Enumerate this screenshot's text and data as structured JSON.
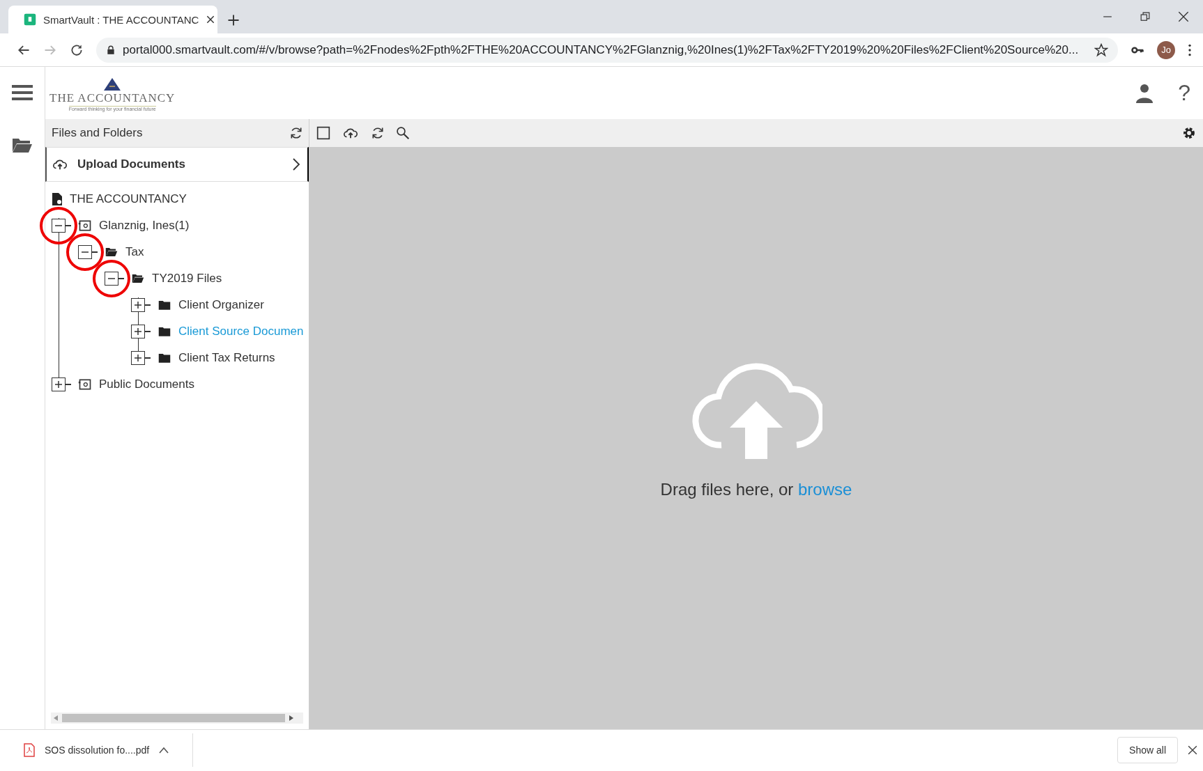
{
  "browser": {
    "tab_title": "SmartVault : THE ACCOUNTANC",
    "url": "portal000.smartvault.com/#/v/browse?path=%2Fnodes%2Fpth%2FTHE%20ACCOUNTANCY%2FGlanznig,%20Ines(1)%2FTax%2FTY2019%20%20Files%2FClient%20Source%20...",
    "profile": "Jo"
  },
  "header": {
    "logo_name": "THE ACCOUNTANCY",
    "logo_tagline": "Forward thinking for your financial future",
    "help": "?"
  },
  "panel": {
    "title": "Files and Folders",
    "upload": "Upload Documents"
  },
  "tree": {
    "label": "THE ACCOUNTANCY",
    "children": [
      {
        "label": "Glanznig, Ines(1)",
        "kind": "vault",
        "expanded": true,
        "selected": false,
        "highlighted": true,
        "children": [
          {
            "label": "Tax",
            "kind": "folder",
            "expanded": true,
            "selected": false,
            "highlighted": true,
            "children": [
              {
                "label": "TY2019 Files",
                "kind": "folder",
                "expanded": true,
                "selected": false,
                "highlighted": true,
                "children": [
                  {
                    "label": "Client Organizer",
                    "kind": "folder",
                    "expanded": false,
                    "selected": false,
                    "highlighted": false
                  },
                  {
                    "label": "Client Source Documen",
                    "kind": "folder",
                    "expanded": false,
                    "selected": true,
                    "highlighted": false
                  },
                  {
                    "label": "Client Tax Returns",
                    "kind": "folder",
                    "expanded": false,
                    "selected": false,
                    "highlighted": false
                  }
                ]
              }
            ]
          }
        ]
      },
      {
        "label": "Public Documents",
        "kind": "vault",
        "expanded": false,
        "selected": false,
        "highlighted": false
      }
    ]
  },
  "dropzone": {
    "text": "Drag files here, or",
    "link": "browse"
  },
  "downloads": {
    "file": "SOS dissolution fo....pdf",
    "show_all": "Show all"
  }
}
